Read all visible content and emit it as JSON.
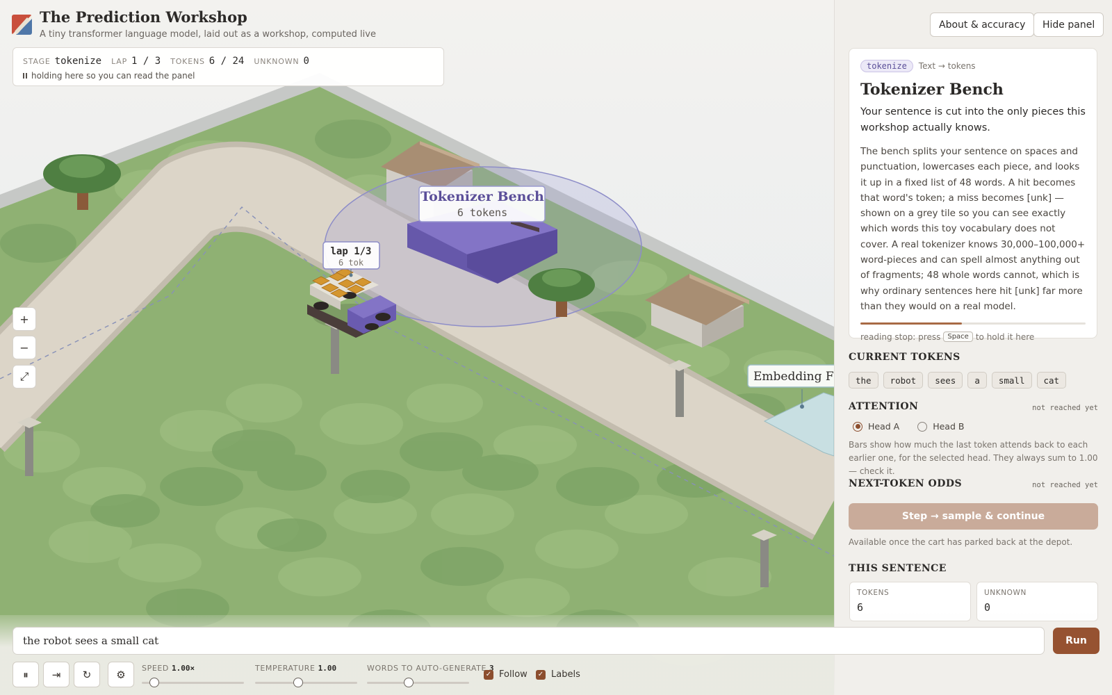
{
  "header": {
    "title": "The Prediction Workshop",
    "subtitle": "A tiny transformer language model, laid out as a workshop, computed live",
    "about_label": "About & accuracy",
    "hide_label": "Hide panel"
  },
  "status": {
    "stage_label": "STAGE",
    "stage": "tokenize",
    "lap_label": "LAP",
    "lap": "1 / 3",
    "tokens_label": "TOKENS",
    "tokens": "6 / 24",
    "unknown_label": "UNKNOWN",
    "unknown": "0",
    "message": "holding here so you can read the panel"
  },
  "zoom": {
    "in": "+",
    "out": "−",
    "fit": "⤢"
  },
  "scene": {
    "station_name": "Tokenizer Bench",
    "station_sub": "6 tokens",
    "cart_label": "lap 1/3",
    "cart_sub": "6 tok",
    "next_station": "Embedding Floor"
  },
  "card": {
    "badge": "tokenize",
    "kind": "Text → tokens",
    "title": "Tokenizer Bench",
    "lead": "Your sentence is cut into the only pieces this workshop actually knows.",
    "body": "The bench splits your sentence on spaces and punctuation, lowercases each piece, and looks it up in a fixed list of 48 words. A hit becomes that word's token; a miss becomes [unk] — shown on a grey tile so you can see exactly which words this toy vocabulary does not cover. A real tokenizer knows 30,000–100,000+ word-pieces and can spell almost anything out of fragments; 48 whole words cannot, which is why ordinary sentences here hit [unk] far more than they would on a real model.",
    "progress": 0.45,
    "hint_pre": "reading stop: press",
    "hint_key": "Space",
    "hint_post": "to hold it here"
  },
  "current_tokens": {
    "heading": "CURRENT TOKENS",
    "items": [
      "the",
      "robot",
      "sees",
      "a",
      "small",
      "cat"
    ]
  },
  "attention": {
    "heading": "ATTENTION",
    "status": "not reached yet",
    "head_a": "Head A",
    "head_b": "Head B",
    "selected": "Head A",
    "desc": "Bars show how much the last token attends back to each earlier one, for the selected head. They always sum to 1.00 — check it."
  },
  "next_token": {
    "heading": "NEXT-TOKEN ODDS",
    "status": "not reached yet",
    "button": "Step → sample & continue",
    "note": "Available once the cart has parked back at the depot."
  },
  "this_sentence": {
    "heading": "THIS SENTENCE",
    "tokens_label": "TOKENS",
    "tokens_value": "6",
    "unknown_label": "UNKNOWN",
    "unknown_value": "0"
  },
  "input": {
    "value": "the robot sees a small cat",
    "run_label": "Run"
  },
  "controls": {
    "pause": "⏸",
    "step": "⇥",
    "reset": "↻",
    "settings": "⚙",
    "speed_label": "SPEED",
    "speed_value": "1.00×",
    "speed_level": 0.12,
    "temperature_label": "TEMPERATURE",
    "temperature_value": "1.00",
    "temperature_level": 0.42,
    "words_label": "WORDS TO AUTO-GENERATE",
    "words_value": "3",
    "words_level": 0.41,
    "follow_label": "Follow",
    "follow_checked": true,
    "labels_label": "Labels",
    "labels_checked": true
  },
  "colors": {
    "accent": "#965231",
    "station": "#6a5bb0",
    "grass": "#8fb173",
    "road": "#dcd5c8"
  }
}
